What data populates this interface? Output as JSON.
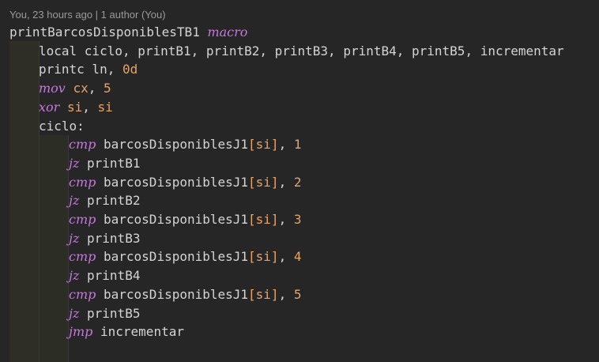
{
  "codelens": "You, 23 hours ago | 1 author (You)",
  "lines": [
    {
      "indent": 0,
      "parts": [
        {
          "t": "printBarcosDisponiblesTB1 ",
          "c": "plain"
        },
        {
          "t": "macro",
          "c": "kw"
        }
      ]
    },
    {
      "indent": 1,
      "parts": [
        {
          "t": "local ciclo, printB1, printB2, printB3, printB4, printB5, incrementar",
          "c": "plain"
        }
      ]
    },
    {
      "indent": 1,
      "parts": [
        {
          "t": "printc ln, ",
          "c": "plain"
        },
        {
          "t": "0d",
          "c": "num"
        }
      ]
    },
    {
      "indent": 1,
      "parts": [
        {
          "t": "mov",
          "c": "kw"
        },
        {
          "t": " ",
          "c": "plain"
        },
        {
          "t": "cx",
          "c": "reg"
        },
        {
          "t": ", ",
          "c": "plain"
        },
        {
          "t": "5",
          "c": "num"
        }
      ]
    },
    {
      "indent": 1,
      "parts": [
        {
          "t": "xor",
          "c": "kw"
        },
        {
          "t": " ",
          "c": "plain"
        },
        {
          "t": "si",
          "c": "reg"
        },
        {
          "t": ", ",
          "c": "plain"
        },
        {
          "t": "si",
          "c": "reg"
        }
      ]
    },
    {
      "indent": 1,
      "parts": [
        {
          "t": "ciclo:",
          "c": "plain"
        }
      ]
    },
    {
      "indent": 2,
      "parts": [
        {
          "t": "cmp",
          "c": "kw"
        },
        {
          "t": " barcosDisponiblesJ1",
          "c": "plain"
        },
        {
          "t": "[si]",
          "c": "reg"
        },
        {
          "t": ", ",
          "c": "plain"
        },
        {
          "t": "1",
          "c": "num"
        }
      ]
    },
    {
      "indent": 2,
      "parts": [
        {
          "t": "jz",
          "c": "kw"
        },
        {
          "t": " printB1",
          "c": "plain"
        }
      ]
    },
    {
      "indent": 2,
      "parts": [
        {
          "t": "cmp",
          "c": "kw"
        },
        {
          "t": " barcosDisponiblesJ1",
          "c": "plain"
        },
        {
          "t": "[si]",
          "c": "reg"
        },
        {
          "t": ", ",
          "c": "plain"
        },
        {
          "t": "2",
          "c": "num"
        }
      ]
    },
    {
      "indent": 2,
      "parts": [
        {
          "t": "jz",
          "c": "kw"
        },
        {
          "t": " printB2",
          "c": "plain"
        }
      ]
    },
    {
      "indent": 2,
      "parts": [
        {
          "t": "cmp",
          "c": "kw"
        },
        {
          "t": " barcosDisponiblesJ1",
          "c": "plain"
        },
        {
          "t": "[si]",
          "c": "reg"
        },
        {
          "t": ", ",
          "c": "plain"
        },
        {
          "t": "3",
          "c": "num"
        }
      ]
    },
    {
      "indent": 2,
      "parts": [
        {
          "t": "jz",
          "c": "kw"
        },
        {
          "t": " printB3",
          "c": "plain"
        }
      ]
    },
    {
      "indent": 2,
      "parts": [
        {
          "t": "cmp",
          "c": "kw"
        },
        {
          "t": " barcosDisponiblesJ1",
          "c": "plain"
        },
        {
          "t": "[si]",
          "c": "reg"
        },
        {
          "t": ", ",
          "c": "plain"
        },
        {
          "t": "4",
          "c": "num"
        }
      ]
    },
    {
      "indent": 2,
      "parts": [
        {
          "t": "jz",
          "c": "kw"
        },
        {
          "t": " printB4",
          "c": "plain"
        }
      ]
    },
    {
      "indent": 2,
      "parts": [
        {
          "t": "cmp",
          "c": "kw"
        },
        {
          "t": " barcosDisponiblesJ1",
          "c": "plain"
        },
        {
          "t": "[si]",
          "c": "reg"
        },
        {
          "t": ", ",
          "c": "plain"
        },
        {
          "t": "5",
          "c": "num"
        }
      ]
    },
    {
      "indent": 2,
      "parts": [
        {
          "t": "jz",
          "c": "kw"
        },
        {
          "t": " printB5",
          "c": "plain"
        }
      ]
    },
    {
      "indent": 2,
      "parts": [
        {
          "t": "jmp",
          "c": "kw"
        },
        {
          "t": " incrementar",
          "c": "plain"
        }
      ]
    }
  ],
  "colors": {
    "background": "#262626",
    "keyword": "#c678dd",
    "register": "#e5a46a",
    "text": "#d4d4d4",
    "codelens": "#9a9a9a"
  }
}
